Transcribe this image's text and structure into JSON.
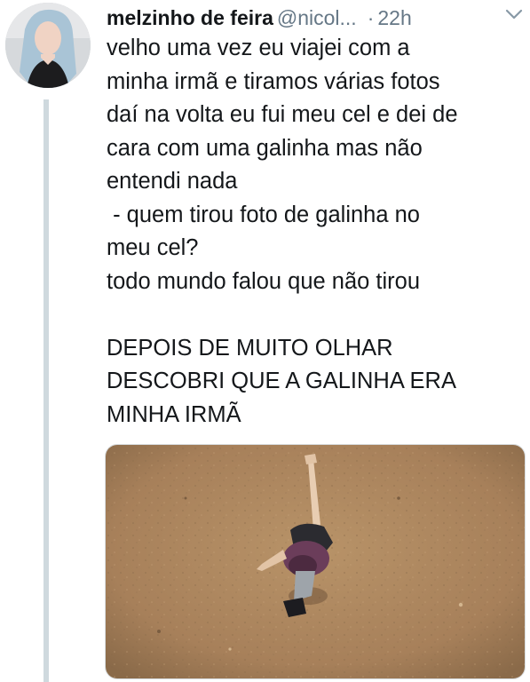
{
  "tweet": {
    "display_name": "melzinho de feira",
    "handle": "@nicol...",
    "separator": "·",
    "time": "22h",
    "text": "velho uma vez eu viajei com a\nminha irmã e tiramos várias fotos\ndaí na volta eu fui meu cel e dei de\ncara com uma galinha mas não\nentendi nada\n - quem tirou foto de galinha no\nmeu cel?\ntodo mundo falou que não tirou\n\nDEPOIS DE MUITO OLHAR\nDESCOBRI QUE A GALINHA ERA\nMINHA IRMÃ"
  },
  "icons": {
    "caret": "chevron-down-icon"
  },
  "colors": {
    "text": "#14171a",
    "muted": "#657786",
    "thread_line": "#cfd9de",
    "photo_ground": "#b08a5e"
  }
}
